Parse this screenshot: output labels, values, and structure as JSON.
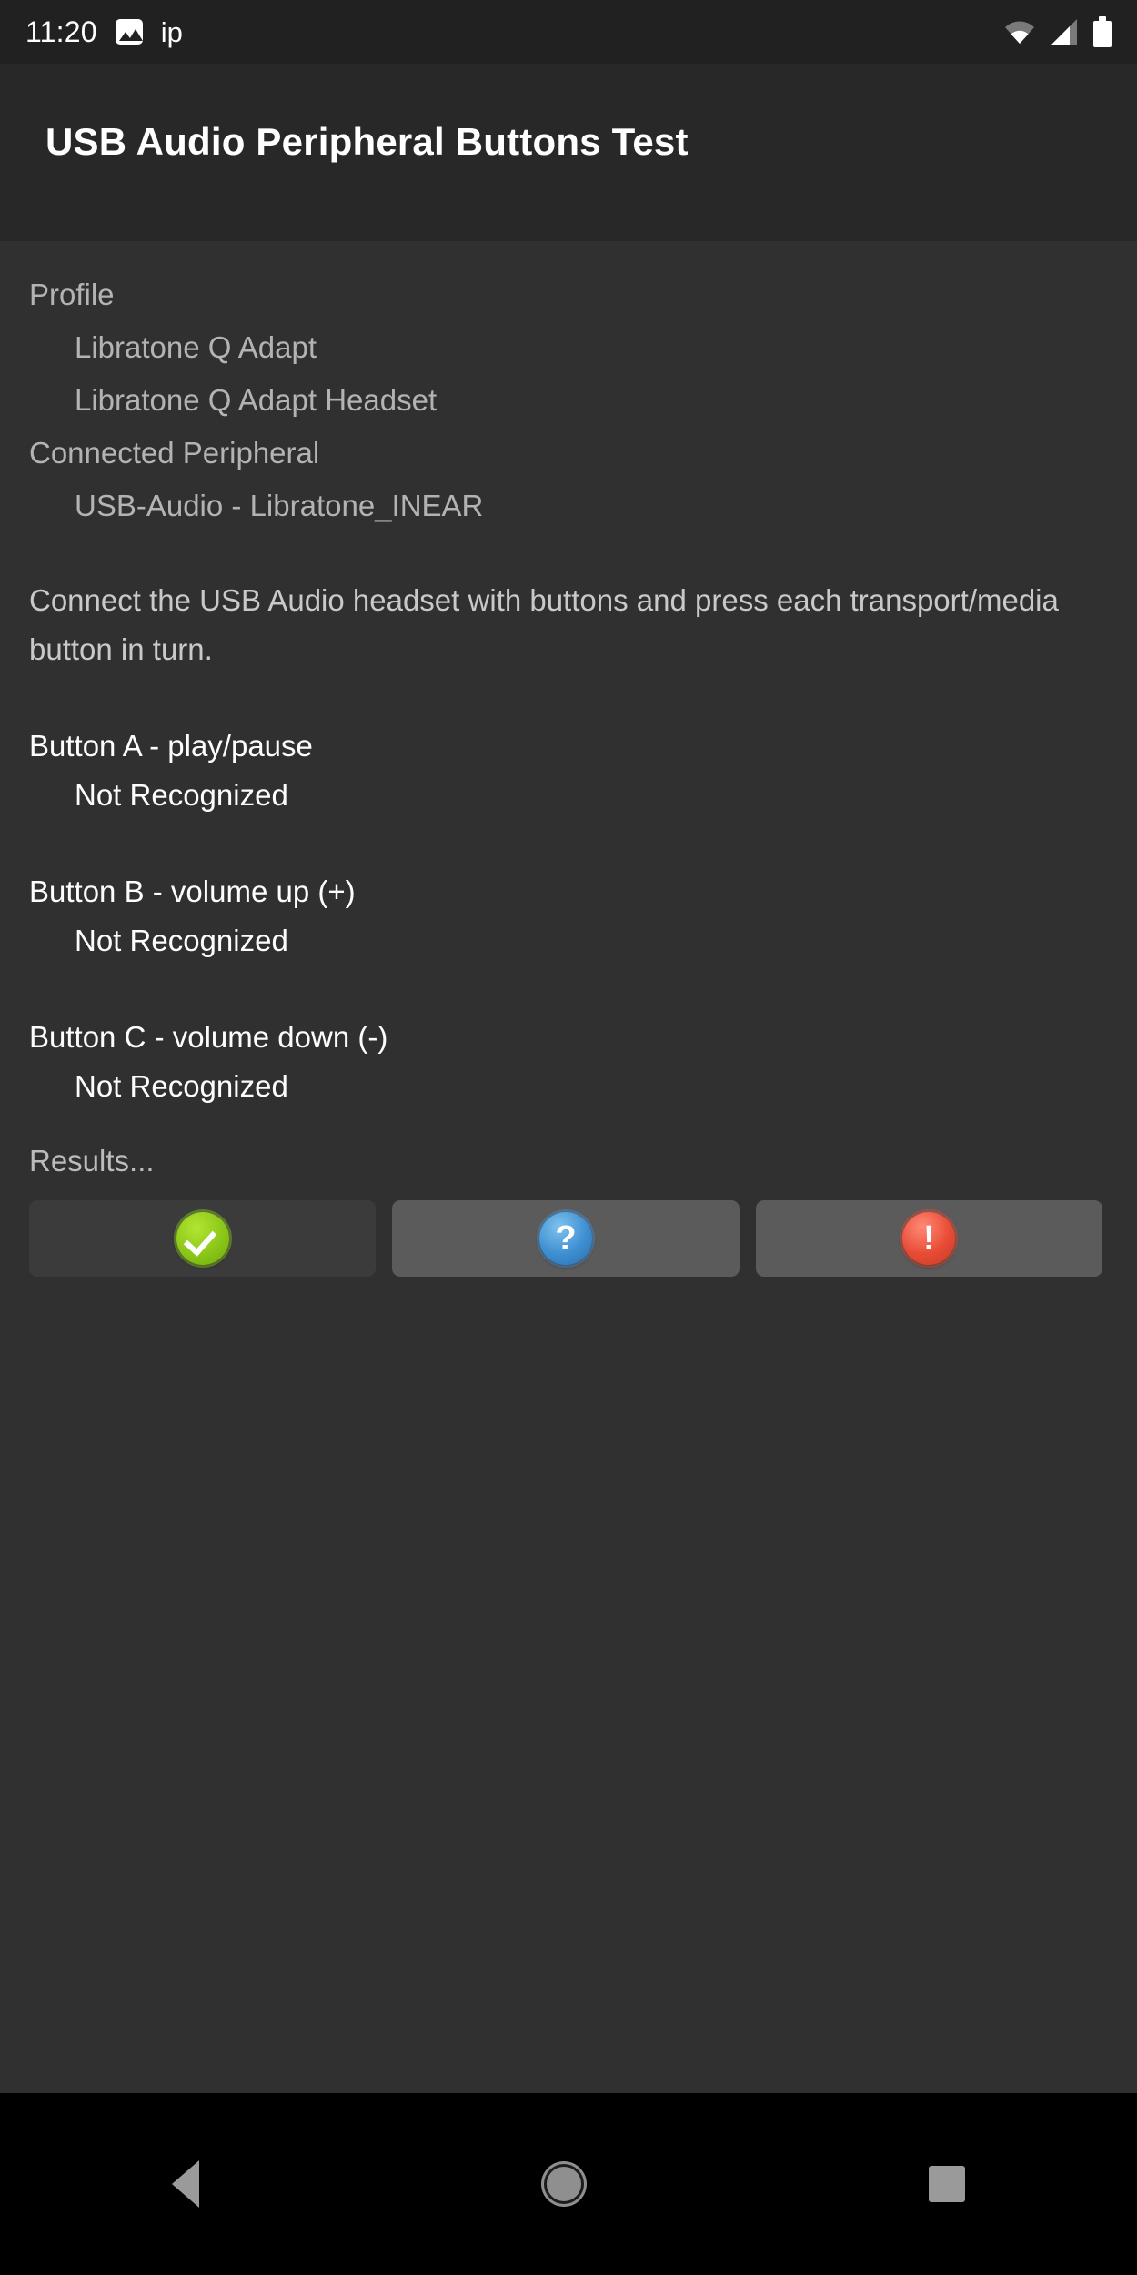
{
  "status_bar": {
    "time": "11:20",
    "notification_icon": "image-icon",
    "notification_label": "ip",
    "right_icons": [
      "wifi-icon",
      "cell-signal-icon",
      "battery-icon"
    ]
  },
  "header": {
    "title": "USB Audio Peripheral Buttons Test"
  },
  "info": {
    "profile_label": "Profile",
    "profile_values": [
      "Libratone Q Adapt",
      "Libratone Q Adapt Headset"
    ],
    "peripheral_label": "Connected Peripheral",
    "peripheral_value": "USB-Audio - Libratone_INEAR"
  },
  "instructions": "Connect the USB Audio headset with buttons and press each transport/media button in turn.",
  "button_tests": [
    {
      "label": "Button A - play/pause",
      "status": "Not Recognized"
    },
    {
      "label": "Button B - volume up (+)",
      "status": "Not Recognized"
    },
    {
      "label": "Button C - volume down (-)",
      "status": "Not Recognized"
    }
  ],
  "results": {
    "label": "Results...",
    "buttons": [
      {
        "name": "pass",
        "icon": "check-circle-icon",
        "glyph": "",
        "enabled": false,
        "color": "#8bc718"
      },
      {
        "name": "info",
        "icon": "question-circle-icon",
        "glyph": "?",
        "enabled": true,
        "color": "#3d8fd1"
      },
      {
        "name": "fail",
        "icon": "exclamation-circle-icon",
        "glyph": "!",
        "enabled": true,
        "color": "#e84b35"
      }
    ]
  },
  "nav_bar": {
    "back": "back-nav-button",
    "home": "home-nav-button",
    "recents": "recents-nav-button"
  },
  "colors": {
    "status_bar_bg": "#212121",
    "header_bg": "#282828",
    "body_bg": "#303030",
    "dim_text": "#b3b3b3",
    "bright_text": "#fdfdfd",
    "nav_bg": "#000000"
  }
}
